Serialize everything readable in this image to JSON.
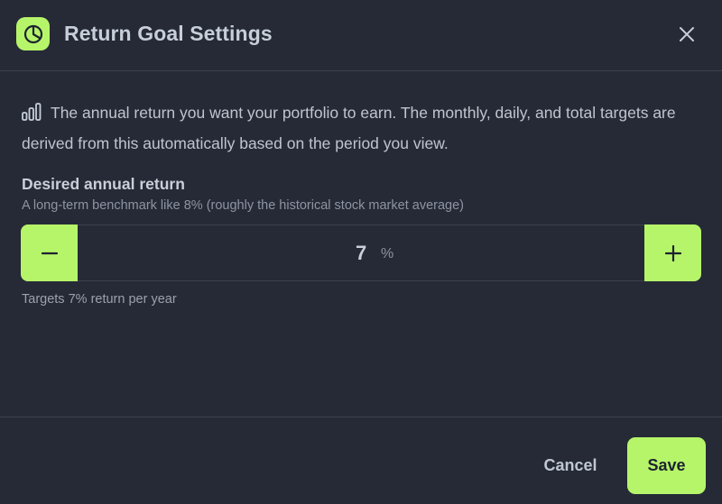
{
  "dialog": {
    "title": "Return Goal Settings",
    "close_icon": "close-icon",
    "app_icon": "pie-chart-icon"
  },
  "description": {
    "icon": "bar-chart-icon",
    "text": "The annual return you want your portfolio to earn. The monthly, daily, and total targets are derived from this automatically based on the period you view."
  },
  "field": {
    "label": "Desired annual return",
    "hint": "A long-term benchmark like 8% (roughly the historical stock market average)",
    "value": "7",
    "unit": "%",
    "summary": "Targets 7% return per year"
  },
  "footer": {
    "cancel_label": "Cancel",
    "save_label": "Save"
  },
  "colors": {
    "accent": "#b6f56a",
    "background": "#262a36",
    "border": "#3c414d"
  }
}
